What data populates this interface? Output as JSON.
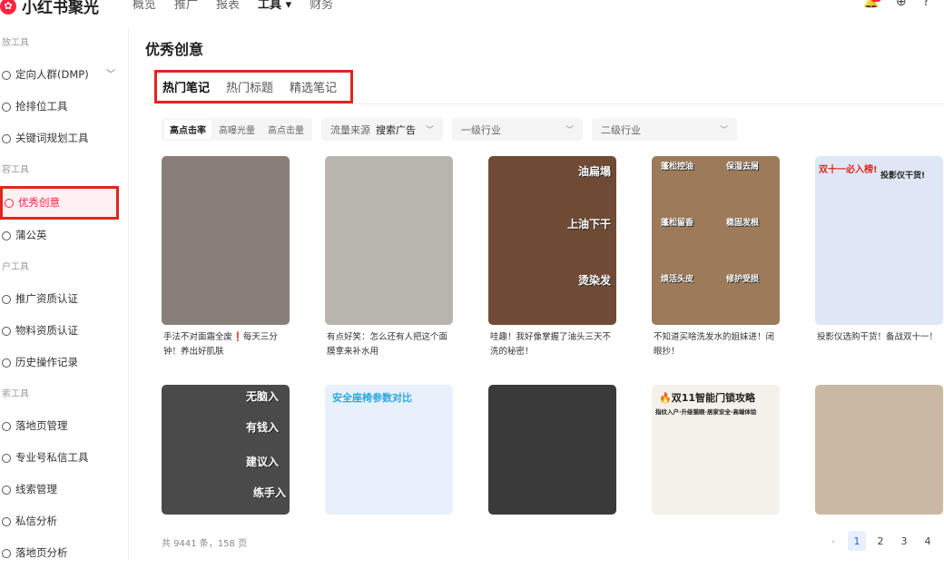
{
  "app": {
    "name": "小红书聚光"
  },
  "topnav": [
    "概览",
    "推广",
    "报表",
    "工具",
    "财务"
  ],
  "topnav_active": "工具",
  "sidebar": {
    "sections": [
      {
        "title": "放工具",
        "items": [
          {
            "label": "定向人群(DMP)",
            "expandable": true
          },
          {
            "label": "抢排位工具"
          },
          {
            "label": "关键词规划工具"
          }
        ]
      },
      {
        "title": "容工具",
        "items": [
          {
            "label": "优秀创意",
            "active": true
          },
          {
            "label": "蒲公英"
          }
        ]
      },
      {
        "title": "户工具",
        "items": [
          {
            "label": "推广资质认证"
          },
          {
            "label": "物料资质认证"
          },
          {
            "label": "历史操作记录"
          }
        ]
      },
      {
        "title": "索工具",
        "items": [
          {
            "label": "落地页管理"
          },
          {
            "label": "专业号私信工具"
          },
          {
            "label": "线索管理"
          },
          {
            "label": "私信分析"
          },
          {
            "label": "落地页分析"
          }
        ]
      }
    ]
  },
  "page": {
    "title": "优秀创意"
  },
  "tabs": [
    {
      "label": "热门笔记",
      "active": true
    },
    {
      "label": "热门标题"
    },
    {
      "label": "精选笔记"
    }
  ],
  "filters": {
    "segments": [
      {
        "label": "高点击率",
        "active": true
      },
      {
        "label": "高曝光量"
      },
      {
        "label": "高点击量"
      }
    ],
    "source_label": "流量来源",
    "source_value": "搜索广告",
    "industry1_placeholder": "一级行业",
    "industry2_placeholder": "二级行业"
  },
  "cards_row1": [
    {
      "caption": "手法不对面霜全废❗️每天三分钟！养出好肌肤",
      "color": "#8a7f78"
    },
    {
      "caption": "有点好笑：怎么还有人把这个面膜拿来补水用",
      "color": "#b8b4ae"
    },
    {
      "caption": "哇趣！我好像掌握了油头三天不洗的秘密！",
      "color": "#6f4b35",
      "overlays": [
        "油扁塌",
        "上油下干",
        "烫染发"
      ]
    },
    {
      "caption": "不知道买啥洗发水的姐妹进！闭眼抄！",
      "color": "#9c7a5a",
      "overlays": [
        "蓬松控油",
        "保湿去屑",
        "蓬松留香",
        "稳固发根",
        "焕活头皮",
        "修护受损"
      ]
    },
    {
      "caption": "投影仪选购干货！备战双十一！",
      "color": "#dfe6f5",
      "overlays": [
        "双十一必入榜!",
        "投影仪干货!"
      ]
    }
  ],
  "cards_row2": [
    {
      "color": "#4a4a4a",
      "overlays": [
        "无脑入",
        "有钱入",
        "建议入",
        "练手入"
      ]
    },
    {
      "color": "#e8f1fb",
      "overlays": [
        "安全座椅参数对比"
      ]
    },
    {
      "color": "#3a3a3a"
    },
    {
      "color": "#f4f1ea",
      "overlays": [
        "🔥双11智能门锁攻略",
        "指纹入户·升级猫眼·居家安全·高端体验"
      ]
    },
    {
      "color": "#c9b8a2"
    }
  ],
  "footer": {
    "count": "共 9441 条，158 页"
  },
  "pager": [
    "1",
    "2",
    "3",
    "4"
  ],
  "pager_active": "1"
}
